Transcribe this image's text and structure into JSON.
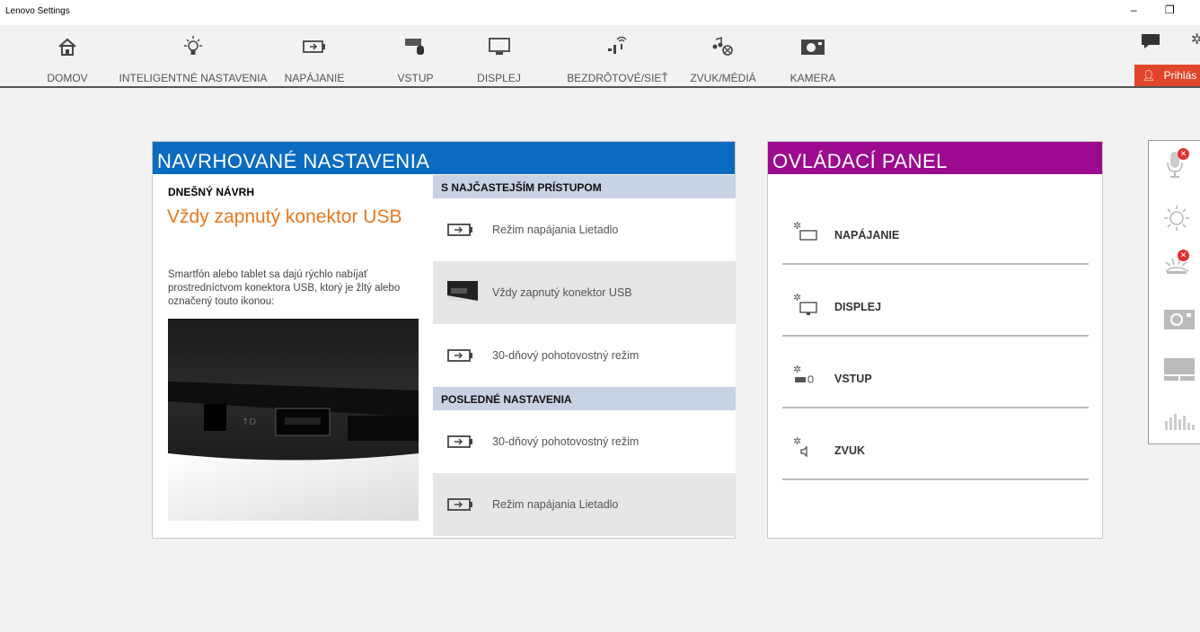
{
  "window": {
    "title": "Lenovo Settings",
    "minimize": "–",
    "restore": "❐"
  },
  "nav": {
    "items": [
      {
        "label": "DOMOV",
        "icon": "home-icon"
      },
      {
        "label": "INTELIGENTNÉ NASTAVENIA",
        "icon": "lightbulb-icon"
      },
      {
        "label": "NAPÁJANIE",
        "icon": "battery-icon"
      },
      {
        "label": "VSTUP",
        "icon": "keyboard-mouse-icon"
      },
      {
        "label": "DISPLEJ",
        "icon": "monitor-icon"
      },
      {
        "label": "BEZDRÔTOVÉ/SIEŤ",
        "icon": "wireless-icon"
      },
      {
        "label": "ZVUK/MÉDIÁ",
        "icon": "music-icon"
      },
      {
        "label": "KAMERA",
        "icon": "camera-icon"
      }
    ],
    "signin_label": "Prihlás",
    "accent": "#e1462c"
  },
  "suggested": {
    "header": "NAVRHOVANÉ NASTAVENIA",
    "header_color": "#0b6bc0",
    "today_title": "DNEŠNÝ NÁVRH",
    "today_heading": "Vždy zapnutý konektor USB",
    "today_description": "Smartfón alebo tablet sa dajú rýchlo nabíjať prostredníctvom konektora USB, ktorý je žltý alebo označený touto ikonou:",
    "frequent_header": "S NAJČASTEJŠÍM PRÍSTUPOM",
    "frequent": [
      {
        "label": "Režim napájania Lietadlo",
        "icon": "battery-icon"
      },
      {
        "label": "Vždy zapnutý konektor USB",
        "icon": "usb-port-icon"
      },
      {
        "label": "30-dňový pohotovostný režim",
        "icon": "battery-icon"
      }
    ],
    "recent_header": "POSLEDNÉ NASTAVENIA",
    "recent": [
      {
        "label": "30-dňový pohotovostný režim",
        "icon": "battery-icon"
      },
      {
        "label": "Režim napájania Lietadlo",
        "icon": "battery-icon"
      }
    ]
  },
  "control_panel": {
    "header": "OVLÁDACÍ PANEL",
    "header_color": "#9c0b8f",
    "items": [
      {
        "label": "NAPÁJANIE",
        "icon": "power-settings-icon"
      },
      {
        "label": "DISPLEJ",
        "icon": "display-settings-icon"
      },
      {
        "label": "VSTUP",
        "icon": "input-settings-icon"
      },
      {
        "label": "ZVUK",
        "icon": "sound-settings-icon"
      }
    ]
  },
  "sidebar": {
    "items": [
      {
        "icon": "microphone-icon",
        "badge": "✕"
      },
      {
        "icon": "brightness-icon"
      },
      {
        "icon": "keyboard-backlight-icon",
        "badge": "✕"
      },
      {
        "icon": "camera-icon"
      },
      {
        "icon": "touchpad-icon"
      },
      {
        "icon": "equalizer-icon"
      }
    ]
  }
}
